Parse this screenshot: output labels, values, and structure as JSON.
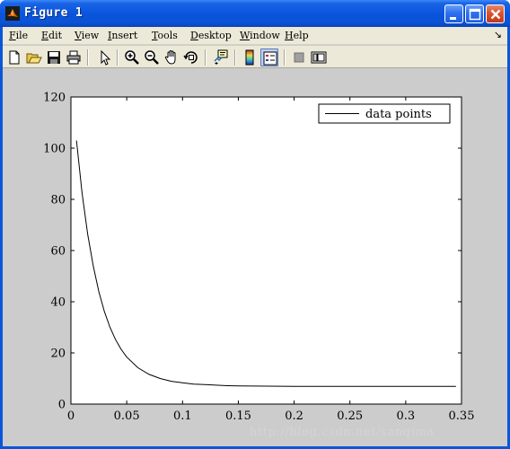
{
  "window": {
    "title": "Figure 1",
    "buttons": {
      "minimize": "minimize",
      "maximize": "maximize",
      "close": "close"
    }
  },
  "menubar": {
    "items": [
      {
        "label": "File",
        "accel": "F"
      },
      {
        "label": "Edit",
        "accel": "E"
      },
      {
        "label": "View",
        "accel": "V"
      },
      {
        "label": "Insert",
        "accel": "I"
      },
      {
        "label": "Tools",
        "accel": "T"
      },
      {
        "label": "Desktop",
        "accel": "D"
      },
      {
        "label": "Window",
        "accel": "W"
      },
      {
        "label": "Help",
        "accel": "H"
      }
    ],
    "overflow_glyph": "↘"
  },
  "toolbar": {
    "icons": [
      "new-figure-icon",
      "open-file-icon",
      "save-icon",
      "print-icon",
      "edit-plot-icon",
      "zoom-in-icon",
      "zoom-out-icon",
      "pan-icon",
      "rotate-3d-icon",
      "data-cursor-icon",
      "colorbar-icon",
      "legend-icon",
      "hide-plot-tools-icon",
      "show-plot-tools-icon"
    ],
    "pressed": [
      "legend-icon"
    ]
  },
  "chart_data": {
    "type": "line",
    "title": "",
    "xlabel": "",
    "ylabel": "",
    "xlim": [
      0,
      0.35
    ],
    "ylim": [
      0,
      120
    ],
    "xticks": [
      0,
      0.05,
      0.1,
      0.15,
      0.2,
      0.25,
      0.3,
      0.35
    ],
    "xtick_labels": [
      "0",
      "0.05",
      "0.1",
      "0.15",
      "0.2",
      "0.25",
      "0.3",
      "0.35"
    ],
    "yticks": [
      0,
      20,
      40,
      60,
      80,
      100,
      120
    ],
    "ytick_labels": [
      "0",
      "20",
      "40",
      "60",
      "80",
      "100",
      "120"
    ],
    "grid": false,
    "legend_position": "top-right",
    "series": [
      {
        "name": "data points",
        "color": "#000000",
        "x": [
          0.005,
          0.01,
          0.015,
          0.02,
          0.025,
          0.03,
          0.035,
          0.04,
          0.045,
          0.05,
          0.06,
          0.07,
          0.08,
          0.09,
          0.1,
          0.11,
          0.12,
          0.13,
          0.14,
          0.15,
          0.2,
          0.25,
          0.3,
          0.345
        ],
        "y": [
          103,
          82.5,
          66.5,
          53.9,
          43.9,
          36.1,
          30.0,
          25.2,
          21.4,
          18.4,
          14.2,
          11.6,
          10.0,
          8.9,
          8.3,
          7.8,
          7.6,
          7.4,
          7.2,
          7.1,
          6.9,
          6.9,
          6.9,
          6.9
        ]
      }
    ]
  },
  "watermark": "http://blog.csdn.net/sanqima"
}
